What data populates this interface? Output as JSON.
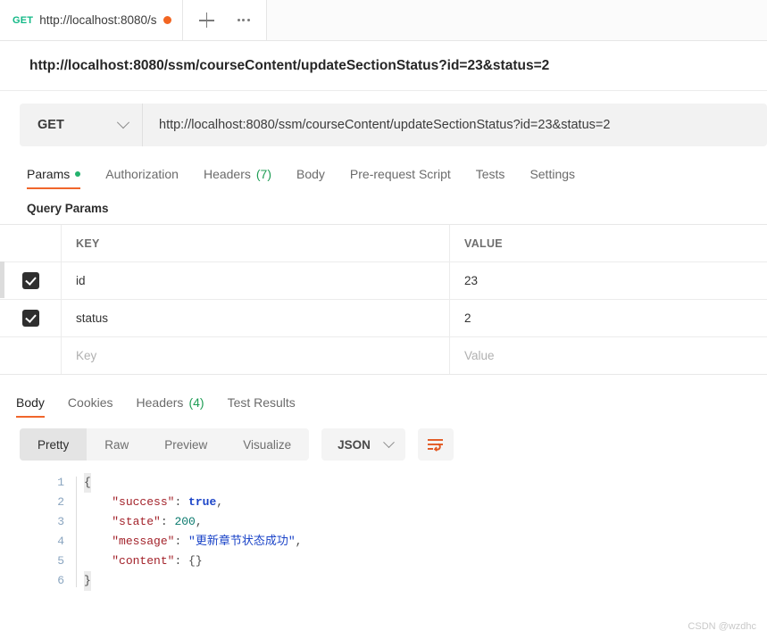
{
  "tabbar": {
    "request_tab": {
      "method": "GET",
      "url_truncated": "http://localhost:8080/s",
      "unsaved_icon": "unsaved-dot"
    },
    "new_tab_icon": "plus-icon",
    "more_icon": "more-options-icon"
  },
  "request": {
    "title": "http://localhost:8080/ssm/courseContent/updateSectionStatus?id=23&status=2",
    "method": "GET",
    "method_chevron_icon": "chevron-down-icon",
    "url": "http://localhost:8080/ssm/courseContent/updateSectionStatus?id=23&status=2",
    "tabs": [
      {
        "label": "Params",
        "dot": true,
        "active": true
      },
      {
        "label": "Authorization",
        "active": false
      },
      {
        "label": "Headers",
        "count": "(7)",
        "active": false
      },
      {
        "label": "Body",
        "active": false
      },
      {
        "label": "Pre-request Script",
        "active": false
      },
      {
        "label": "Tests",
        "active": false
      },
      {
        "label": "Settings",
        "active": false
      }
    ],
    "query_params_title": "Query Params",
    "table": {
      "headers": {
        "key": "KEY",
        "value": "VALUE"
      },
      "rows": [
        {
          "checked": true,
          "key": "id",
          "value": "23"
        },
        {
          "checked": true,
          "key": "status",
          "value": "2"
        }
      ],
      "placeholder_row": {
        "key": "Key",
        "value": "Value"
      }
    }
  },
  "response": {
    "tabs": [
      {
        "label": "Body",
        "active": true
      },
      {
        "label": "Cookies",
        "active": false
      },
      {
        "label": "Headers",
        "count": "(4)",
        "active": false
      },
      {
        "label": "Test Results",
        "active": false
      }
    ],
    "formats": [
      {
        "label": "Pretty",
        "active": true
      },
      {
        "label": "Raw",
        "active": false
      },
      {
        "label": "Preview",
        "active": false
      },
      {
        "label": "Visualize",
        "active": false
      }
    ],
    "language": "JSON",
    "language_chevron_icon": "chevron-down-icon",
    "wrap_icon": "word-wrap-icon",
    "body_lines": [
      {
        "n": "1",
        "open_brace": "{"
      },
      {
        "n": "2",
        "key": "\"success\"",
        "sep": ": ",
        "bool": "true",
        "tail": ","
      },
      {
        "n": "3",
        "key": "\"state\"",
        "sep": ": ",
        "num": "200",
        "tail": ","
      },
      {
        "n": "4",
        "key": "\"message\"",
        "sep": ": ",
        "str": "\"更新章节状态成功\"",
        "tail": ","
      },
      {
        "n": "5",
        "key": "\"content\"",
        "sep": ": ",
        "obj": "{}"
      },
      {
        "n": "6",
        "close_brace": "}"
      }
    ]
  },
  "watermark": "CSDN @wzdhc"
}
